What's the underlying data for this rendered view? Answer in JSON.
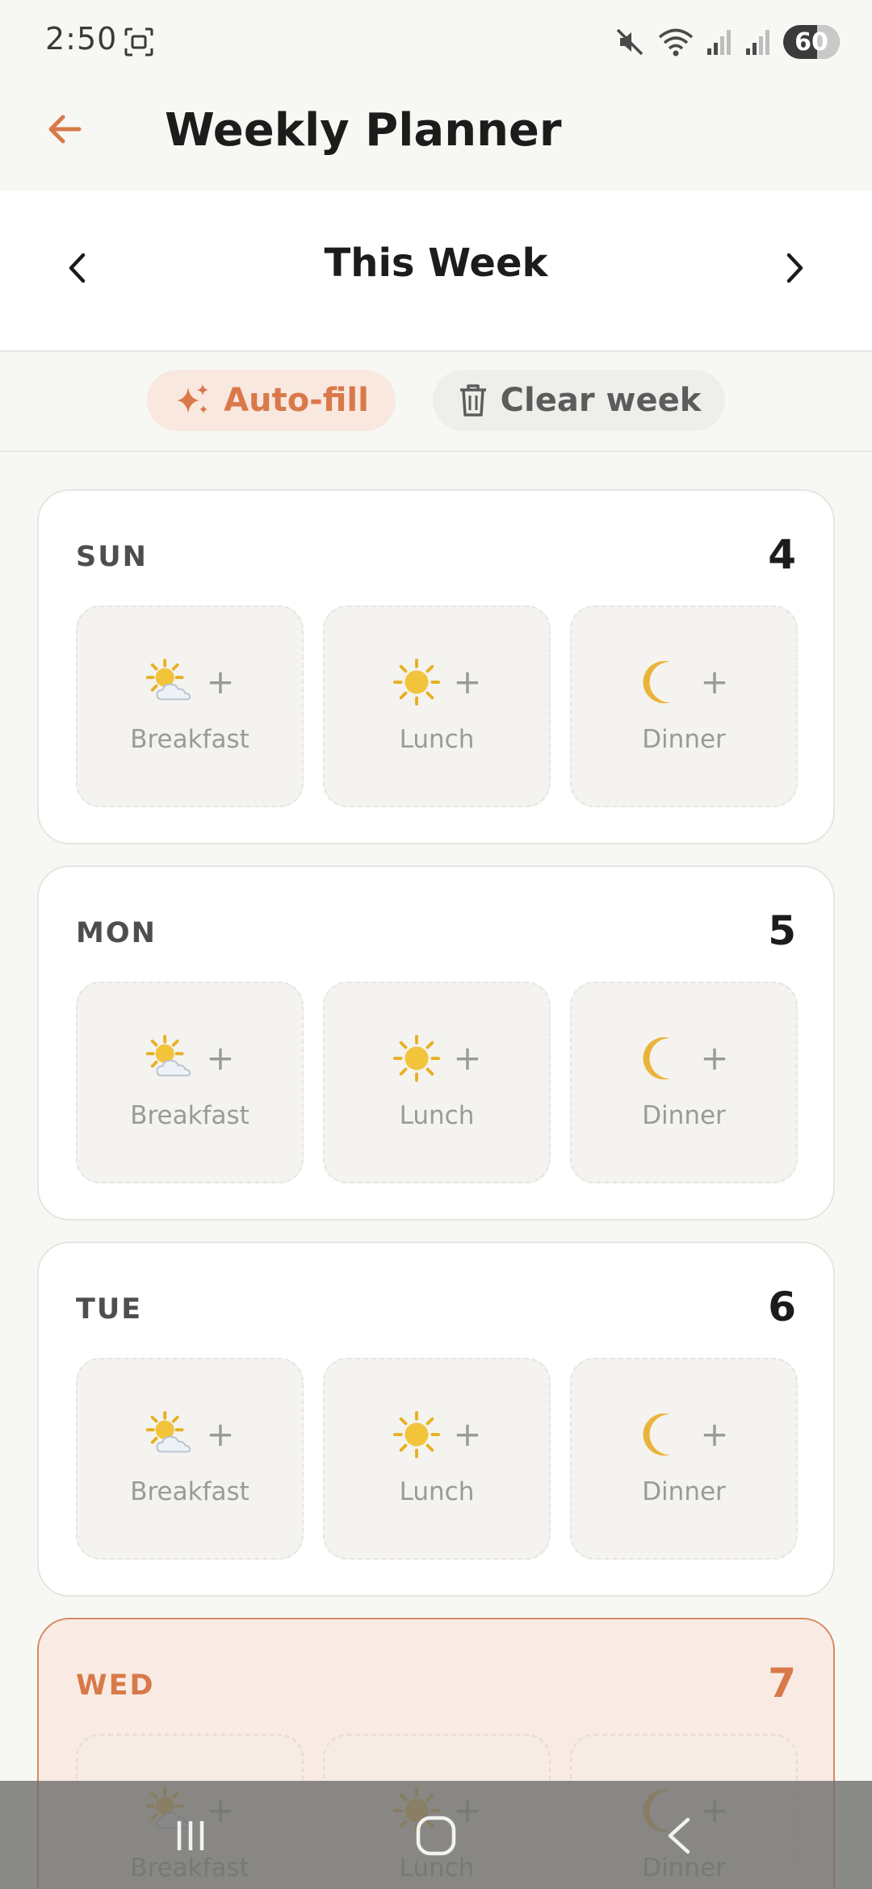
{
  "status_bar": {
    "time": "2:50",
    "battery_level": "60",
    "battery_fraction": 0.6,
    "icons": [
      "screenshot-icon",
      "mute-icon",
      "wifi-icon",
      "signal-icon",
      "signal-icon"
    ]
  },
  "app_bar": {
    "title": "Weekly Planner",
    "back_icon": "arrow-left-icon"
  },
  "week_nav": {
    "label": "This Week",
    "prev_icon": "chevron-left-icon",
    "next_icon": "chevron-right-icon"
  },
  "actions": {
    "autofill_label": "Auto-fill",
    "clear_label": "Clear week"
  },
  "meal_types": [
    {
      "label": "Breakfast",
      "icon": "sun-behind-cloud-icon"
    },
    {
      "label": "Lunch",
      "icon": "sun-icon"
    },
    {
      "label": "Dinner",
      "icon": "crescent-moon-icon"
    }
  ],
  "days": [
    {
      "name": "SUN",
      "date": "4",
      "today": false
    },
    {
      "name": "MON",
      "date": "5",
      "today": false
    },
    {
      "name": "TUE",
      "date": "6",
      "today": false
    },
    {
      "name": "WED",
      "date": "7",
      "today": true
    }
  ],
  "plus_symbol": "+",
  "colors": {
    "accent": "#D9794A",
    "accent_soft": "#F9E8DF",
    "background": "#F7F8F3",
    "card": "#FFFFFF",
    "slot": "#F4F3F0",
    "muted_text": "#9A9A9A"
  }
}
